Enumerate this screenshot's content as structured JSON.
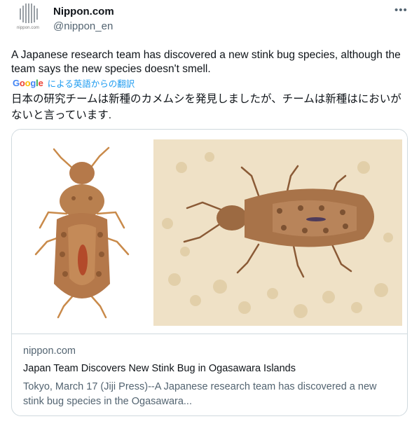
{
  "author": {
    "name": "Nippon.com",
    "handle": "@nippon_en",
    "avatar_caption": "nippon.com"
  },
  "more_icon": "more-horizontal-icon",
  "tweet": {
    "text": "A Japanese research team has discovered a new stink bug species, although the team says the new species doesn't smell.",
    "translate_label": "による英語からの翻訳",
    "translated_text": "日本の研究チームは新種のカメムシを発見しましたが、チームは新種はにおいがないと言っています."
  },
  "google_logo": {
    "letters": [
      "G",
      "o",
      "o",
      "g",
      "l",
      "e"
    ],
    "colors": [
      "#4285f4",
      "#ea4335",
      "#fbbc05",
      "#4285f4",
      "#34a853",
      "#ea4335"
    ]
  },
  "card": {
    "domain": "nippon.com",
    "title": "Japan Team Discovers New Stink Bug in Ogasawara Islands",
    "description": "Tokyo, March 17 (Jiji Press)--A Japanese research team has discovered a new stink bug species in the Ogasawara..."
  },
  "colors": {
    "link": "#1d9bf0",
    "muted": "#536471",
    "border": "#cfd9de"
  }
}
